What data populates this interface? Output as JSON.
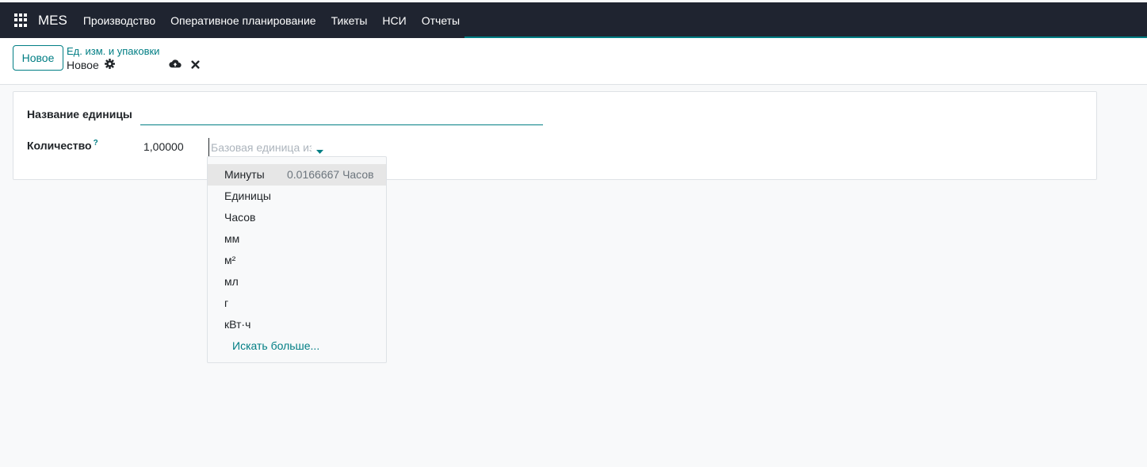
{
  "navbar": {
    "brand": "MES",
    "menu": [
      "Производство",
      "Оперативное планирование",
      "Тикеты",
      "НСИ",
      "Отчеты"
    ]
  },
  "control_panel": {
    "new_button_label": "Новое",
    "breadcrumb": "Ед. изм. и упаковки",
    "record_title": "Новое"
  },
  "form": {
    "name_label": "Название единицы",
    "name_value": "",
    "qty_label": "Количество",
    "qty_help": "?",
    "qty_value": "1,00000",
    "uom_placeholder": "Базовая единица изм"
  },
  "dropdown": {
    "items": [
      {
        "label": "Минуты",
        "meta": "0.0166667 Часов",
        "active": true
      },
      {
        "label": "Единицы",
        "meta": ""
      },
      {
        "label": "Часов",
        "meta": ""
      },
      {
        "label": "мм",
        "meta": ""
      },
      {
        "label": "м²",
        "meta": ""
      },
      {
        "label": "мл",
        "meta": ""
      },
      {
        "label": "г",
        "meta": ""
      },
      {
        "label": "кВт·ч",
        "meta": ""
      }
    ],
    "search_more": "Искать больше..."
  },
  "colors": {
    "navbar_bg": "#1f2430",
    "accent": "#017e84",
    "page_bg": "#f8f9fa"
  }
}
